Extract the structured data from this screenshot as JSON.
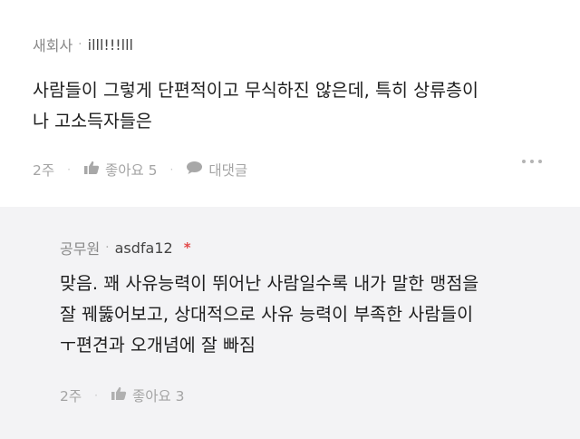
{
  "comment": {
    "company": "새회사",
    "nickname": "illl!!!lll",
    "lines": [
      "사람들이 그렇게 단편적이고 무식하진 않은데, 특히 상류층이",
      "나 고소득자들은"
    ],
    "time": "2주",
    "like_label": "좋아요 5",
    "reply_label": "대댓글",
    "icons": {
      "like": "thumbs-up-icon",
      "reply": "speech-bubble-icon",
      "more": "more-dots-icon"
    }
  },
  "reply": {
    "company": "공무원",
    "nickname": "asdfa12",
    "author_mark": "*",
    "lines": [
      "맞음. 꽤 사유능력이 뛰어난 사람일수록 내가 말한 맹점을",
      "잘 꿰뚫어보고, 상대적으로 사유 능력이 부족한 사람들이",
      "ㅜ편견과 오개념에 잘 빠짐"
    ],
    "time": "2주",
    "like_label": "좋아요 3",
    "icons": {
      "like": "thumbs-up-icon"
    }
  },
  "colors": {
    "star": "#e24a4a",
    "comment_bg": "#ffffff",
    "reply_bg": "#f3f3f5"
  }
}
